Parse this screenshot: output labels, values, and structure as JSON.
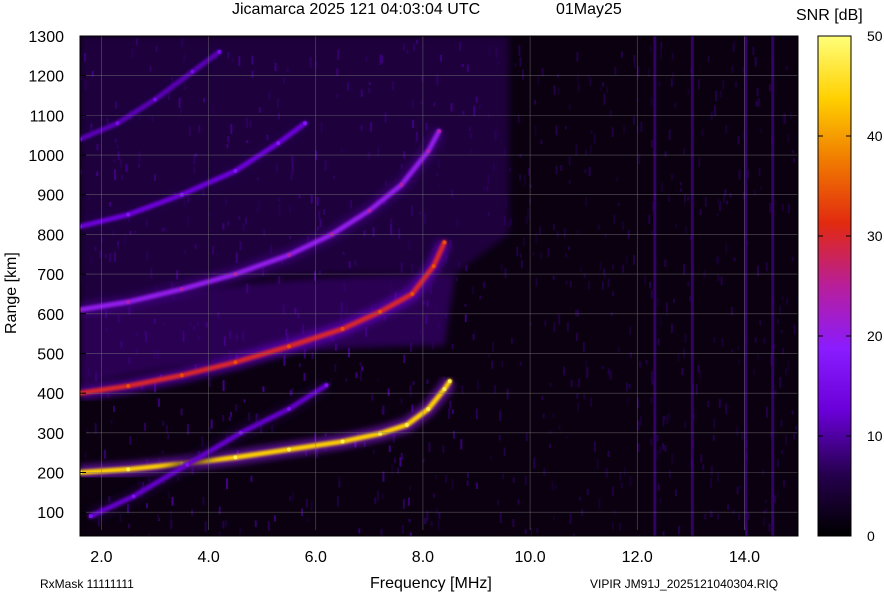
{
  "chart_data": {
    "type": "heatmap",
    "title": "Jicamarca 2025 121 04:03:04 UTC",
    "date_label": "01May25",
    "xlabel": "Frequency [MHz]",
    "ylabel": "Range [km]",
    "x_ticks": [
      "2.0",
      "4.0",
      "6.0",
      "8.0",
      "10.0",
      "12.0",
      "14.0"
    ],
    "y_ticks": [
      "100",
      "200",
      "300",
      "400",
      "500",
      "600",
      "700",
      "800",
      "900",
      "1000",
      "1100",
      "1200",
      "1300"
    ],
    "xlim": [
      1.6,
      15.0
    ],
    "ylim": [
      40,
      1300
    ],
    "colorbar": {
      "label": "SNR [dB]",
      "ticks": [
        "0",
        "10",
        "20",
        "30",
        "40",
        "50"
      ],
      "range": [
        0,
        50
      ],
      "colormap": [
        "#000000",
        "#26004f",
        "#6a00d8",
        "#8a1cff",
        "#b81e9a",
        "#e22a10",
        "#f07a00",
        "#ffd000",
        "#ffff7a"
      ]
    },
    "traces": [
      {
        "role": "O-mode F-trace",
        "x": [
          1.6,
          2.5,
          3.5,
          4.5,
          5.5,
          6.5,
          7.2,
          7.7,
          8.1,
          8.4,
          8.5
        ],
        "y": [
          200,
          208,
          222,
          238,
          258,
          278,
          298,
          320,
          360,
          410,
          430
        ],
        "snr": 44
      },
      {
        "role": "second-hop F-trace",
        "x": [
          1.6,
          2.5,
          3.5,
          4.5,
          5.5,
          6.5,
          7.2,
          7.8,
          8.2,
          8.4
        ],
        "y": [
          400,
          418,
          445,
          478,
          518,
          562,
          605,
          650,
          720,
          780
        ],
        "snr": 30
      },
      {
        "role": "third-hop F-trace",
        "x": [
          1.6,
          2.5,
          3.5,
          4.5,
          5.5,
          6.3,
          7.0,
          7.6,
          8.1,
          8.3
        ],
        "y": [
          610,
          630,
          662,
          700,
          748,
          800,
          860,
          925,
          1010,
          1060
        ],
        "snr": 20
      },
      {
        "role": "fourth-hop trace",
        "x": [
          1.6,
          2.5,
          3.5,
          4.5,
          5.3,
          5.8
        ],
        "y": [
          820,
          850,
          900,
          960,
          1030,
          1080
        ],
        "snr": 13
      },
      {
        "role": "fifth-hop trace",
        "x": [
          1.6,
          2.3,
          3.0,
          3.7,
          4.2
        ],
        "y": [
          1040,
          1080,
          1140,
          1210,
          1260
        ],
        "snr": 11
      },
      {
        "role": "lower X-mode trace",
        "x": [
          1.8,
          2.6,
          3.6,
          4.6,
          5.5,
          6.2
        ],
        "y": [
          90,
          140,
          220,
          300,
          360,
          420
        ],
        "snr": 12
      }
    ]
  },
  "footer": {
    "rxmask": "RxMask 11111111",
    "file": "VIPIR  JM91J_2025121040304.RIQ"
  }
}
